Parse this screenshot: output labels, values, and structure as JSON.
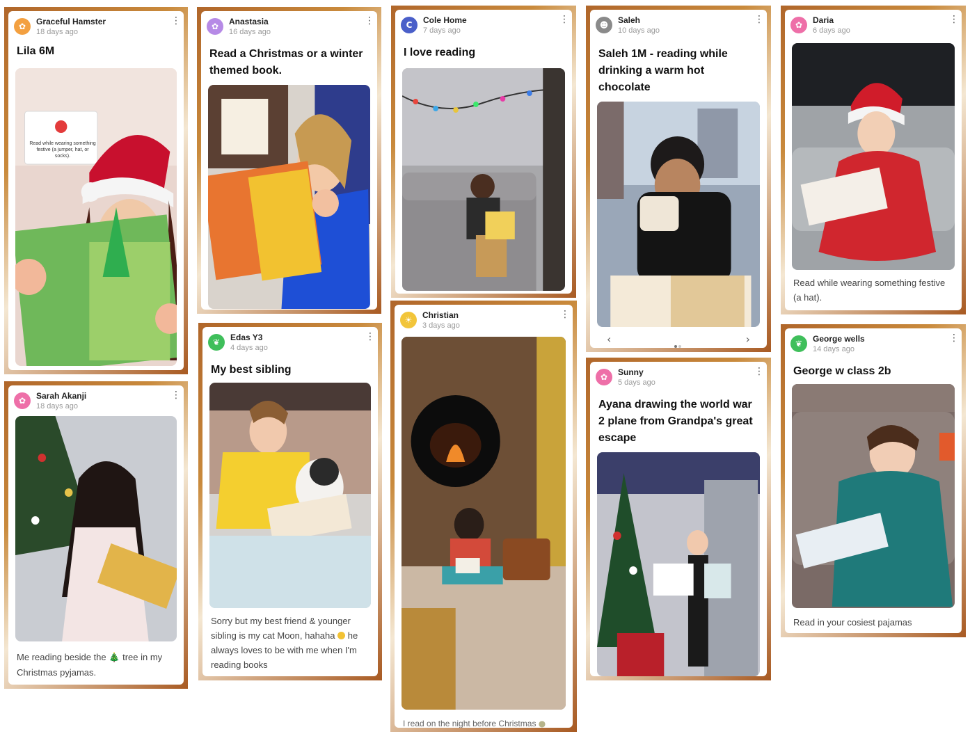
{
  "posts": [
    {
      "author": "Graceful Hamster",
      "ago": "18 days ago",
      "avatar_icon": "hamster-icon",
      "avatar_color": "#f3a040",
      "title": "Lila 6M",
      "caption": "",
      "photo_alt": "Girl in santa hat reading a book",
      "badge_text": "Read while wearing something festive (a jumper, hat, or socks)."
    },
    {
      "author": "Anastasia",
      "ago": "16 days ago",
      "avatar_icon": "flower-icon",
      "avatar_color": "#b68ae6",
      "title": "Read a Christmas or a winter themed book.",
      "caption": "",
      "photo_alt": "Girl reading a Christmas book"
    },
    {
      "author": "Cole Home",
      "ago": "7 days ago",
      "avatar_letter": "C",
      "avatar_color": "#4a5fc9",
      "title": "I love reading",
      "caption": "",
      "photo_alt": "Boy reading on a sofa"
    },
    {
      "author": "Saleh",
      "ago": "10 days ago",
      "avatar_icon": "robot-icon",
      "avatar_color": "#8a8a8a",
      "title": "Saleh 1M - reading while drinking a warm hot chocolate",
      "caption": "",
      "photo_alt": "Boy drinking hot chocolate while reading",
      "carousel": {
        "prev": "‹",
        "next": "›"
      }
    },
    {
      "author": "Daria",
      "ago": "6 days ago",
      "avatar_icon": "flower-icon",
      "avatar_color": "#ee6fa8",
      "title": "",
      "caption": "Read while wearing something festive (a hat).",
      "photo_alt": "Girl in santa hat reading"
    },
    {
      "author": "Sarah Akanji",
      "ago": "18 days ago",
      "avatar_icon": "flower-icon",
      "avatar_color": "#ee6fa8",
      "title": "",
      "caption_parts": [
        "Me reading beside the",
        "tree in my Christmas pyjamas."
      ],
      "photo_alt": "Girl reading beside the Christmas tree"
    },
    {
      "author": "Edas Y3",
      "ago": "4 days ago",
      "avatar_icon": "plant-icon",
      "avatar_color": "#3fbf5b",
      "title": "My best sibling",
      "caption_parts": [
        "Sorry but my best friend & younger sibling is my cat Moon, hahaha",
        "he always loves to be with me when I'm reading books"
      ],
      "photo_alt": "Boy reading with a cat"
    },
    {
      "author": "Christian",
      "ago": "3 days ago",
      "avatar_icon": "sun-icon",
      "avatar_color": "#f2c53a",
      "title": "",
      "caption": "I read on the night before Christmas",
      "photo_alt": "Boy reading by the fireplace"
    },
    {
      "author": "Sunny",
      "ago": "5 days ago",
      "avatar_icon": "flower-icon",
      "avatar_color": "#ee6fa8",
      "title": "Ayana drawing the world war 2 plane from Grandpa's great escape",
      "caption": "",
      "photo_alt": "Girl showing a drawing by the Christmas tree"
    },
    {
      "author": "George wells",
      "ago": "14 days ago",
      "avatar_icon": "plant-icon",
      "avatar_color": "#3fbf5b",
      "title": "George w class 2b",
      "caption": "Read in your cosiest pajamas",
      "photo_alt": "Boy reading in pajamas"
    }
  ],
  "icons": {
    "kebab": "⋮",
    "tree": "🎄"
  }
}
